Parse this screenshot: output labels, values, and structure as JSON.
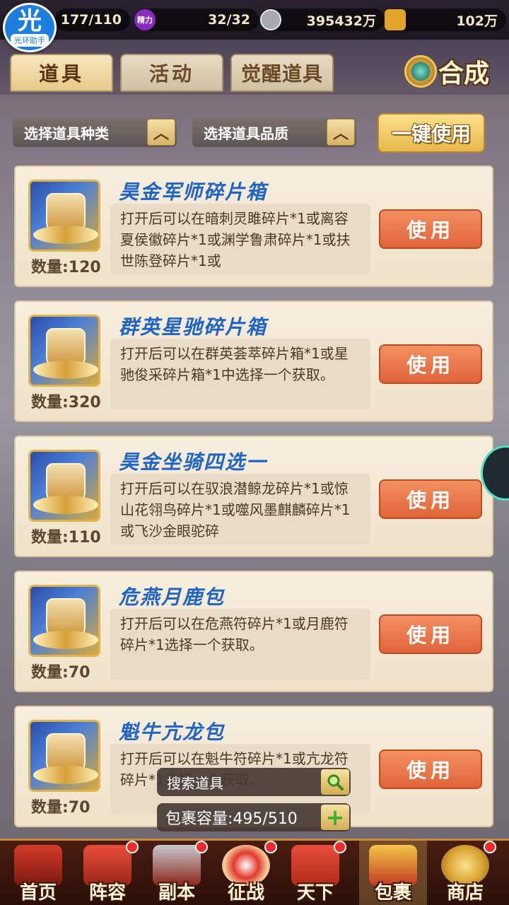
{
  "top_bar": {
    "logo_char": "光",
    "logo_text": "光环助手",
    "stamina": "177/110",
    "energy_label": "精力",
    "energy": "32/32",
    "silver": "395432万",
    "gold": "102万"
  },
  "tabs": [
    {
      "label": "道具",
      "active": true
    },
    {
      "label": "活动",
      "active": false
    },
    {
      "label": "觉醒道具",
      "active": false
    }
  ],
  "compose_label": "合成",
  "filters": {
    "type_label": "选择道具种类",
    "quality_label": "选择道具品质",
    "arrow_glyph": "︿"
  },
  "use_all_label": "一键使用",
  "items": [
    {
      "name": "昊金军师碎片箱",
      "count": "数量:120",
      "description": "打开后可以在暗刺灵雎碎片*1或离容夏侯徽碎片*1或渊学鲁肃碎片*1或扶世陈登碎片*1或",
      "use_label": "使用"
    },
    {
      "name": "群英星驰碎片箱",
      "count": "数量:320",
      "description": "打开后可以在群英荟萃碎片箱*1或星驰俊采碎片箱*1中选择一个获取。",
      "use_label": "使用"
    },
    {
      "name": "昊金坐骑四选一",
      "count": "数量:110",
      "description": "打开后可以在驭浪潜鲸龙碎片*1或惊山花翎鸟碎片*1或噬风墨麒麟碎片*1或飞沙金眼驼碎",
      "use_label": "使用"
    },
    {
      "name": "危燕月鹿包",
      "count": "数量:70",
      "description": "打开后可以在危燕符碎片*1或月鹿符碎片*1选择一个获取。",
      "use_label": "使用"
    },
    {
      "name": "魁牛亢龙包",
      "count": "数量:70",
      "description": "打开后可以在魁牛符碎片*1或亢龙符碎片*1选择一个获取。",
      "use_label": "使用"
    }
  ],
  "search": {
    "label": "搜索道具",
    "icon": "magnifier-icon"
  },
  "capacity": {
    "label": "包裹容量:495/510",
    "icon": "plus-icon"
  },
  "bottom_nav": [
    {
      "label": "首页",
      "badge": false,
      "active": false
    },
    {
      "label": "阵容",
      "badge": true,
      "active": false
    },
    {
      "label": "副本",
      "badge": true,
      "active": false
    },
    {
      "label": "征战",
      "badge": true,
      "active": false
    },
    {
      "label": "天下",
      "badge": true,
      "active": false
    },
    {
      "label": "包裹",
      "badge": false,
      "active": true
    },
    {
      "label": "商店",
      "badge": true,
      "active": false
    }
  ],
  "colors": {
    "accent_blue": "#1f64c8",
    "use_button": "#e0643a",
    "use_all_button": "#e7b84a",
    "badge_red": "#ef2a2a"
  }
}
